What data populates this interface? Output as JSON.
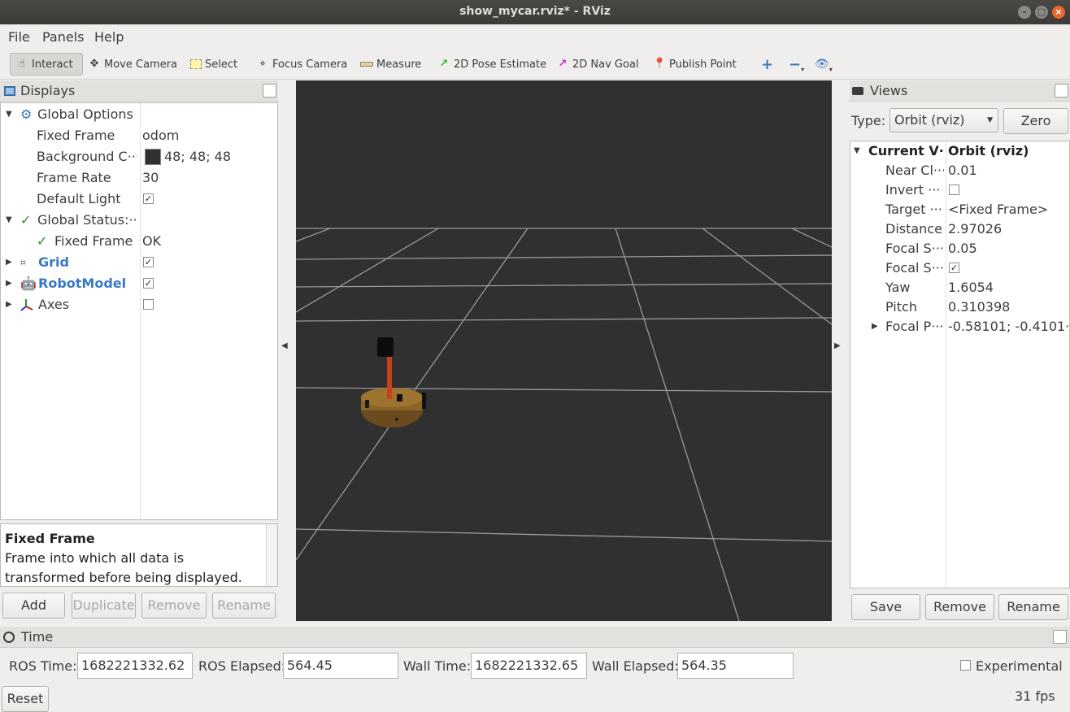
{
  "window": {
    "title": "show_mycar.rviz* - RViz"
  },
  "menubar": {
    "file": "File",
    "panels": "Panels",
    "help": "Help"
  },
  "toolbar": {
    "interact": "Interact",
    "move_camera": "Move Camera",
    "select": "Select",
    "focus_camera": "Focus Camera",
    "measure": "Measure",
    "pose_estimate": "2D Pose Estimate",
    "nav_goal": "2D Nav Goal",
    "publish_point": "Publish Point"
  },
  "displays": {
    "title": "Displays",
    "tree": {
      "global_options": "Global Options",
      "fixed_frame_label": "Fixed Frame",
      "fixed_frame_value": "odom",
      "bg_color_label": "Background C···",
      "bg_color_value": "48; 48; 48",
      "frame_rate_label": "Frame Rate",
      "frame_rate_value": "30",
      "default_light_label": "Default Light",
      "global_status": "Global Status:···",
      "status_fixed_frame_label": "Fixed Frame",
      "status_fixed_frame_value": "OK",
      "grid": "Grid",
      "robot_model": "RobotModel",
      "axes": "Axes"
    },
    "description": {
      "title": "Fixed Frame",
      "text": "Frame into which all data is transformed before being displayed."
    },
    "buttons": {
      "add": "Add",
      "duplicate": "Duplicate",
      "remove": "Remove",
      "rename": "Rename"
    }
  },
  "views": {
    "title": "Views",
    "type_label": "Type:",
    "type_value": "Orbit (rviz)",
    "zero": "Zero",
    "rows": {
      "current_view_label": "Current V···",
      "current_view_value": "Orbit (rviz)",
      "near_clip_label": "Near Cl···",
      "near_clip_value": "0.01",
      "invert_label": "Invert ···",
      "target_label": "Target ···",
      "target_value": "<Fixed Frame>",
      "distance_label": "Distance",
      "distance_value": "2.97026",
      "focal_size_label": "Focal S···",
      "focal_size_value": "0.05",
      "focal_shape_label": "Focal S···",
      "yaw_label": "Yaw",
      "yaw_value": "1.6054",
      "pitch_label": "Pitch",
      "pitch_value": "0.310398",
      "focal_point_label": "Focal P···",
      "focal_point_value": "-0.58101; -0.4101···"
    },
    "buttons": {
      "save": "Save",
      "remove": "Remove",
      "rename": "Rename"
    }
  },
  "time": {
    "title": "Time",
    "ros_time_label": "ROS Time:",
    "ros_time_value": "1682221332.62",
    "ros_elapsed_label": "ROS Elapsed:",
    "ros_elapsed_value": "564.45",
    "wall_time_label": "Wall Time:",
    "wall_time_value": "1682221332.65",
    "wall_elapsed_label": "Wall Elapsed:",
    "wall_elapsed_value": "564.35",
    "experimental": "Experimental",
    "reset": "Reset",
    "fps": "31 fps"
  },
  "colors": {
    "viewport_bg": "#303030",
    "accent_blue": "#3a78c4",
    "ok_green": "#2b8a2b"
  }
}
